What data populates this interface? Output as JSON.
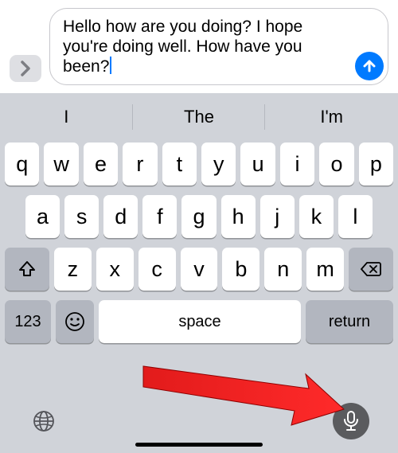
{
  "compose": {
    "message_text": "Hello how are you doing? I hope you're doing well. How have you been?"
  },
  "suggestions": [
    "I",
    "The",
    "I'm"
  ],
  "keys": {
    "row1": [
      "q",
      "w",
      "e",
      "r",
      "t",
      "y",
      "u",
      "i",
      "o",
      "p"
    ],
    "row2": [
      "a",
      "s",
      "d",
      "f",
      "g",
      "h",
      "j",
      "k",
      "l"
    ],
    "row3": [
      "z",
      "x",
      "c",
      "v",
      "b",
      "n",
      "m"
    ],
    "numbers": "123",
    "space": "space",
    "return": "return"
  }
}
